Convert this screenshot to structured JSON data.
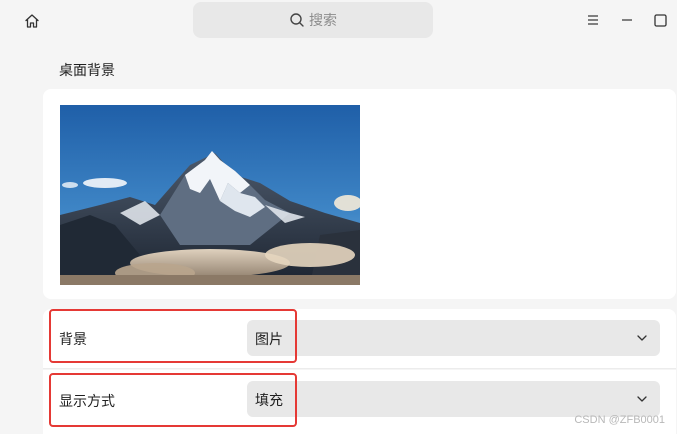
{
  "header": {
    "search_placeholder": "搜索"
  },
  "icons": {
    "home": "home-icon",
    "search": "search-icon",
    "menu": "menu-icon",
    "minimize": "minimize-icon",
    "maximize": "maximize-icon",
    "chevron": "chevron-down-icon"
  },
  "section": {
    "title": "桌面背景"
  },
  "settings": {
    "background": {
      "label": "背景",
      "value": "图片"
    },
    "display_mode": {
      "label": "显示方式",
      "value": "填充"
    }
  },
  "annotation_color": "#e53935",
  "watermark": "CSDN @ZFB0001"
}
